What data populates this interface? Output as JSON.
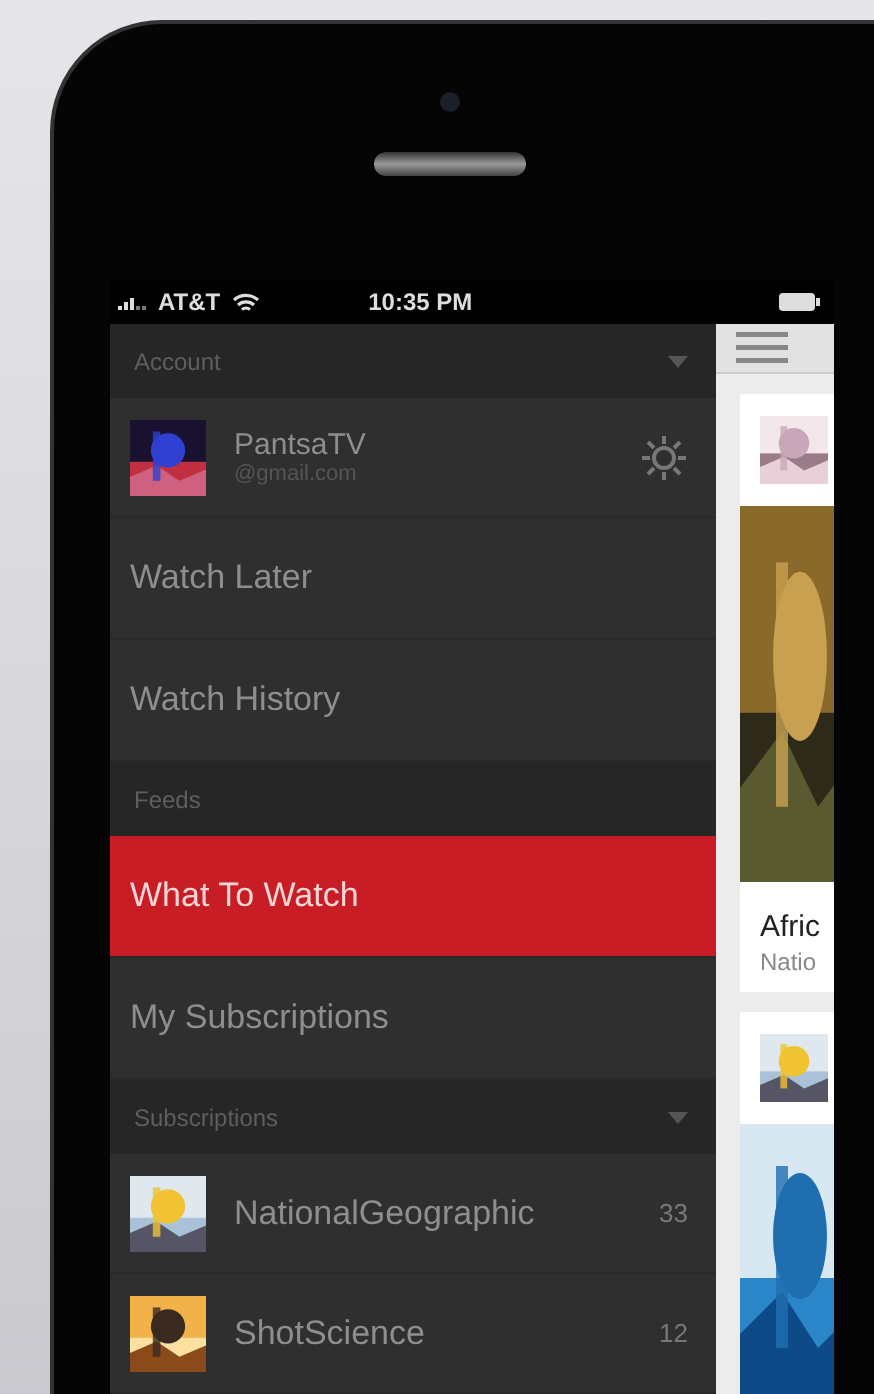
{
  "status_bar": {
    "carrier": "AT&T",
    "time": "10:35 PM"
  },
  "drawer": [
    {
      "kind": "header",
      "label": "Account",
      "collapsible": true
    },
    {
      "kind": "account",
      "name": "PantsaTV",
      "email": "@gmail.com"
    },
    {
      "kind": "item",
      "label": "Watch Later",
      "selected": false
    },
    {
      "kind": "item",
      "label": "Watch History",
      "selected": false
    },
    {
      "kind": "header",
      "label": "Feeds",
      "collapsible": false
    },
    {
      "kind": "item",
      "label": "What To Watch",
      "selected": true
    },
    {
      "kind": "item",
      "label": "My Subscriptions",
      "selected": false
    },
    {
      "kind": "header",
      "label": "Subscriptions",
      "collapsible": true
    },
    {
      "kind": "channel",
      "label": "NationalGeographic",
      "count": "33"
    },
    {
      "kind": "channel",
      "label": "ShotScience",
      "count": "12"
    }
  ],
  "feed": {
    "cards": [
      {
        "title": "Afric",
        "channel": "Natio"
      }
    ]
  }
}
